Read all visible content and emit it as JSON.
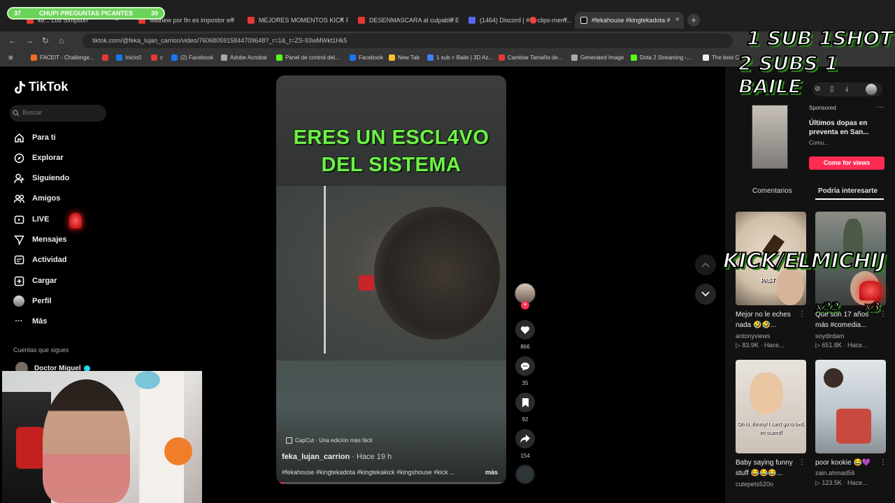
{
  "browser": {
    "tabs": [
      {
        "label": "ke... Los Simpson"
      },
      {
        "label": "Midnew por fin es impostor en"
      },
      {
        "label": "MEJORES MOMENTOS KICK PE..."
      },
      {
        "label": "DESENMASCARA al culpable El..."
      },
      {
        "label": "(1464) Discord | #🔴clips-mem..."
      },
      {
        "label": "#fekahouse #kingtekadota #"
      }
    ],
    "url": "tiktok.com/@feka_lujan_carrion/video/7606805915844709648?_r=1&_t=ZS-93wMWkt1Hk5",
    "bookmarks": [
      "FACEIT - Challenge...",
      "Inicio0",
      "c",
      "(2) Facebook",
      "Adobe Acrobat",
      "Panel de control del...",
      "Facebook",
      "New Tab",
      "1 sub = Baile | 3D Az...",
      "Cambiar Tamaño de...",
      "Generated Image",
      "Dota 2 Streaming -...",
      "The best C"
    ]
  },
  "sidebar": {
    "logo": "TikTok",
    "search_placeholder": "Buscar",
    "items": [
      {
        "label": "Para ti"
      },
      {
        "label": "Explorar"
      },
      {
        "label": "Siguiendo"
      },
      {
        "label": "Amigos"
      },
      {
        "label": "LIVE"
      },
      {
        "label": "Mensajes"
      },
      {
        "label": "Actividad"
      },
      {
        "label": "Cargar"
      },
      {
        "label": "Perfil"
      },
      {
        "label": "Más"
      }
    ],
    "following_title": "Cuentas que sigues",
    "following_user": "Doctor Miguel"
  },
  "video": {
    "caption_line1": "ERES UN ESCL4VO",
    "caption_line2": "DEL SISTEMA",
    "capcut": "CapCut · Una edición más fácil",
    "author": "feka_lujan_carrion",
    "time": "· Hace 19 h",
    "tags": "#fekahouse #kingtekadota #kingtekakick #kingshouse #kick ...",
    "more": "más",
    "progress": 0.03,
    "likes": "866",
    "comments": "35",
    "saves": "92",
    "shares": "154"
  },
  "right_panel": {
    "sponsored": {
      "label": "Sponsored",
      "title": "Últimos dopas en preventa en San...",
      "sub": "Comu...",
      "button": "Come for views"
    },
    "tabs": [
      "Comentarios",
      "Podría interesarte"
    ],
    "cards": [
      {
        "title": "Mejor no le eches nada 🤣🤣...",
        "user": "antonyviews",
        "views": "83.9K · Hace...",
        "thumb_text": "PAST"
      },
      {
        "title": "Que son 17 años más #comedia...",
        "user": "soydirdam",
        "views": "651.8K · Hace...",
        "thumb_text": ""
      },
      {
        "title": "Baby saying funny stuff 😂😂😂...",
        "user": "cutepets520o",
        "views": "",
        "thumb_text": "Oh hi, Emmy! I can't go to bed, im scared!"
      },
      {
        "title": "poor kookie 😂💜",
        "user": "zain.ahmad56",
        "views": "123.5K · Hace...",
        "thumb_text": ""
      }
    ]
  },
  "overlay": {
    "chupi": "CHUPI PREGUNTAS PICANTES",
    "chupi_left": "37",
    "chupi_right": "30",
    "line1": "1 SUB 1SHOT",
    "line2": "2 SUBS 1 BAILE",
    "kick": "KICK/ELMICHIJ",
    "x22": "x22",
    "x3": "x3"
  },
  "colors": {
    "accent": "#fe2c55",
    "caption_green": "#6ff048",
    "bg": "#000000"
  }
}
